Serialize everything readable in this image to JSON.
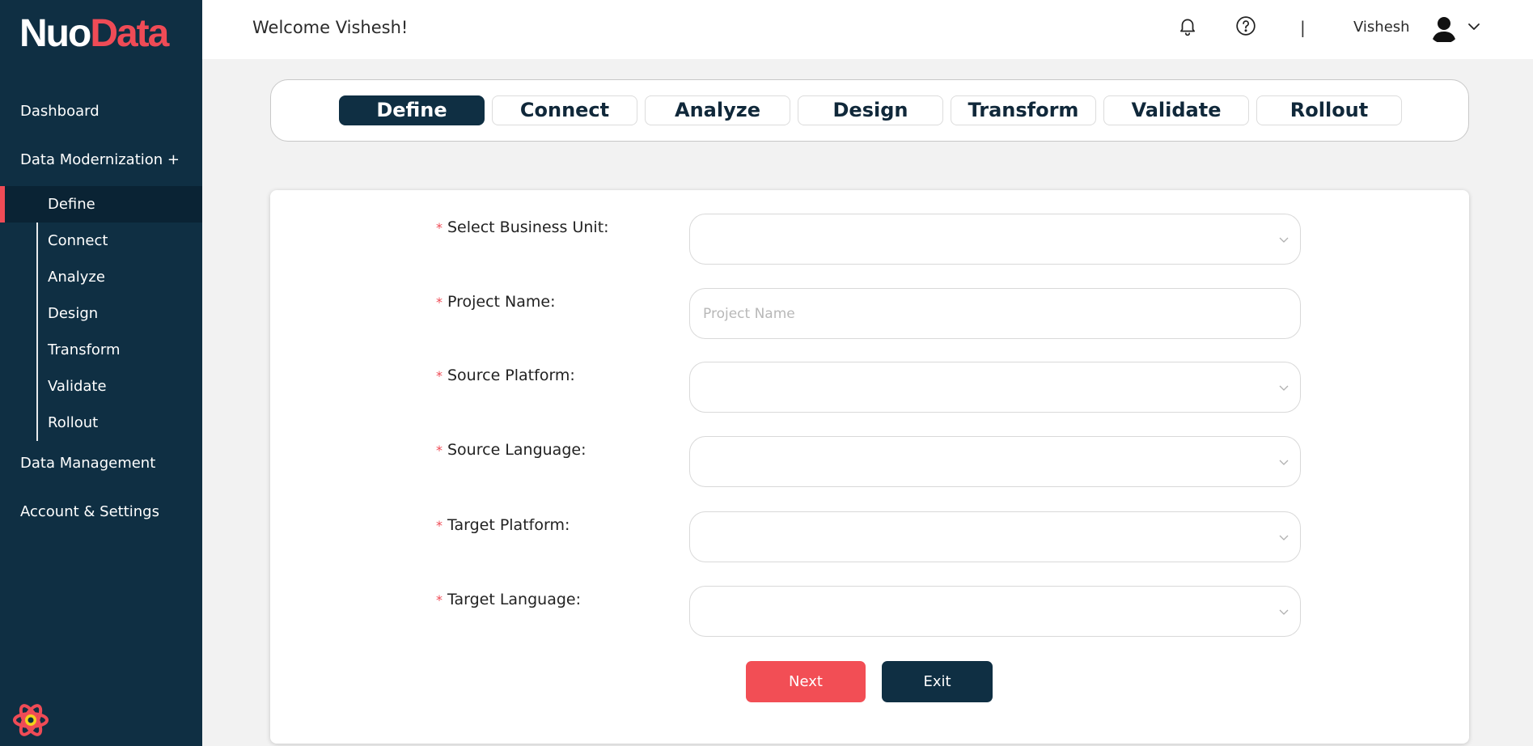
{
  "sidebar": {
    "logo": {
      "part1": "Nuo",
      "part2": "Data"
    },
    "top_items": {
      "dashboard": "Dashboard",
      "modernization": "Data Modernization +",
      "management": "Data Management",
      "account": "Account & Settings"
    },
    "sub_items": [
      "Define",
      "Connect",
      "Analyze",
      "Design",
      "Transform",
      "Validate",
      "Rollout"
    ],
    "active_sub_item": "Define"
  },
  "header": {
    "welcome": "Welcome Vishesh!",
    "separator": "|",
    "username": "Vishesh",
    "icons": [
      "bell-icon",
      "help-icon",
      "avatar",
      "chevron-down-icon"
    ]
  },
  "steps": {
    "items": [
      "Define",
      "Connect",
      "Analyze",
      "Design",
      "Transform",
      "Validate",
      "Rollout"
    ],
    "active": "Define"
  },
  "form": {
    "business_unit": {
      "label": "Select Business Unit:",
      "value": ""
    },
    "project_name": {
      "label": "Project Name:",
      "placeholder": "Project Name",
      "value": ""
    },
    "source_platform": {
      "label": "Source Platform:",
      "value": ""
    },
    "source_language": {
      "label": "Source Language:",
      "value": ""
    },
    "target_platform": {
      "label": "Target Platform:",
      "value": ""
    },
    "target_language": {
      "label": "Target Language:",
      "value": ""
    },
    "required_marker": "*",
    "next_label": "Next",
    "exit_label": "Exit"
  },
  "colors": {
    "sidebar_bg": "#0f2f43",
    "accent": "#ef4b56",
    "page_bg": "#f2f2f2"
  }
}
